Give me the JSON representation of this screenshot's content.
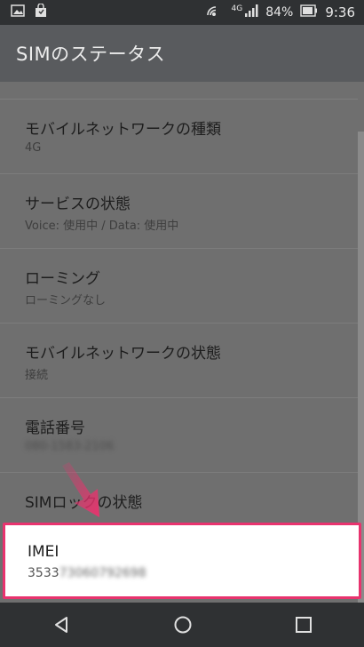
{
  "status_bar": {
    "network": "4G",
    "battery_percent": "84%",
    "time": "9:36"
  },
  "app_bar": {
    "title": "SIMのステータス"
  },
  "items": [
    {
      "title": "モバイルネットワークの種類",
      "value": "4G"
    },
    {
      "title": "サービスの状態",
      "value": "Voice: 使用中 / Data: 使用中"
    },
    {
      "title": "ローミング",
      "value": "ローミングなし"
    },
    {
      "title": "モバイルネットワークの状態",
      "value": "接続"
    },
    {
      "title": "電話番号",
      "value": "080-1583-2106"
    },
    {
      "title": "SIMロックの状態",
      "value": ""
    }
  ],
  "imei": {
    "title": "IMEI",
    "value_visible": "3533",
    "value_hidden": "73060792698"
  },
  "colors": {
    "highlight": "#e8336e",
    "arrow": "#e8336e"
  },
  "icons": [
    "image-icon",
    "shopping-bag-icon",
    "wifi-calling-icon",
    "signal-icon",
    "battery-icon",
    "back-icon",
    "home-icon",
    "recents-icon"
  ]
}
